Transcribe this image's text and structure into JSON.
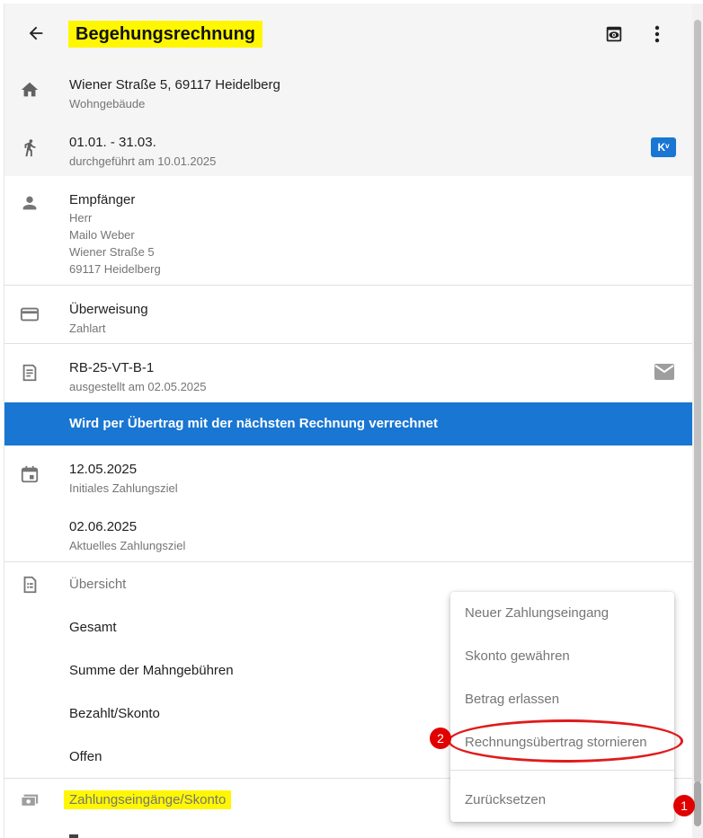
{
  "header": {
    "title": "Begehungsrechnung",
    "back_icon": "arrow-left-icon",
    "preview_icon": "eye-preview-icon",
    "more_icon": "more-vertical-icon"
  },
  "property": {
    "address": "Wiener Straße 5, 69117 Heidelberg",
    "type": "Wohngebäude"
  },
  "inspection": {
    "period": "01.01. - 31.03.",
    "performed": "durchgeführt am 10.01.2025",
    "badge": "Kᵛ"
  },
  "recipient": {
    "label": "Empfänger",
    "salutation": "Herr",
    "name": "Mailo Weber",
    "street": "Wiener Straße 5",
    "city": "69117 Heidelberg"
  },
  "payment": {
    "method": "Überweisung",
    "label": "Zahlart"
  },
  "invoice": {
    "number": "RB-25-VT-B-1",
    "issued": "ausgestellt am 02.05.2025"
  },
  "banner": {
    "text": "Wird per Übertrag mit der nächsten Rechnung verrechnet"
  },
  "due": {
    "initial_date": "12.05.2025",
    "initial_label": "Initiales Zahlungsziel",
    "current_date": "02.06.2025",
    "current_label": "Aktuelles Zahlungsziel"
  },
  "overview": {
    "heading": "Übersicht",
    "items": [
      "Gesamt",
      "Summe der Mahngebühren",
      "Bezahlt/Skonto",
      "Offen"
    ]
  },
  "payments_section": {
    "heading": "Zahlungseingänge/Skonto"
  },
  "menu": {
    "items": [
      "Neuer Zahlungseingang",
      "Skonto gewähren",
      "Betrag erlassen",
      "Rechnungsübertrag stornieren",
      "Zurücksetzen"
    ]
  },
  "annotations": {
    "marker1": "1",
    "marker2": "2"
  },
  "colors": {
    "accent": "#1976d2",
    "highlight": "#fff700",
    "annotation": "#e00000"
  }
}
